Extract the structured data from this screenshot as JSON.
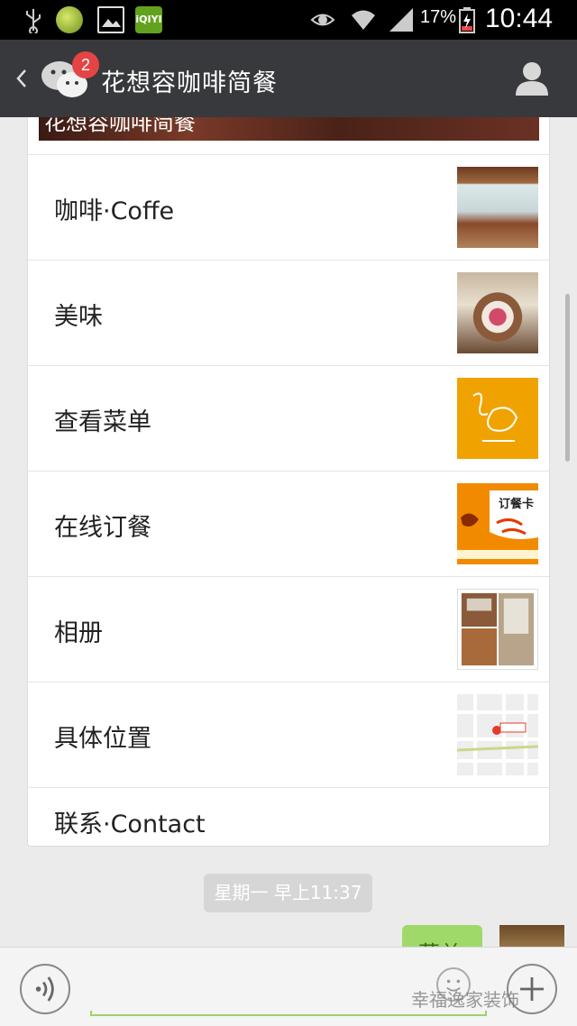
{
  "status_bar": {
    "battery_percent": "17%",
    "time": "10:44",
    "icons": [
      "usb-icon",
      "app-icon",
      "gallery-icon",
      "iqiyi-icon",
      "eye-icon",
      "wifi-icon",
      "signal-icon",
      "battery-icon"
    ],
    "iqiyi_label": "iQIYI"
  },
  "header": {
    "title": "花想容咖啡简餐",
    "unread_badge": "2",
    "back_icon": "chevron-left-icon",
    "app_icon": "wechat-icon",
    "profile_icon": "person-icon"
  },
  "article": {
    "banner_title": "花想容咖啡简餐",
    "items": [
      {
        "label": "咖啡·Coffe",
        "thumbnail": "cafe-interior-photo"
      },
      {
        "label": "美味",
        "thumbnail": "dessert-photo"
      },
      {
        "label": "查看菜单",
        "thumbnail": "menu-logo-image"
      },
      {
        "label": "在线订餐",
        "thumbnail": "order-card-image"
      },
      {
        "label": "相册",
        "thumbnail": "album-collage"
      },
      {
        "label": "具体位置",
        "thumbnail": "map-image"
      },
      {
        "label": "联系·Contact",
        "thumbnail": ""
      }
    ],
    "order_card_text": "订餐卡"
  },
  "chat": {
    "timestamp": "星期一 早上11:37",
    "outgoing_partial_text": "菜单"
  },
  "input_bar": {
    "voice_icon": "voice-icon",
    "emoji_icon": "emoji-icon",
    "plus_icon": "plus-icon",
    "watermark": "幸福逸家装饰"
  },
  "colors": {
    "title_bar": "#38393c",
    "badge": "#e44444",
    "bubble_green": "#9fd96a",
    "background": "#ebebeb"
  }
}
